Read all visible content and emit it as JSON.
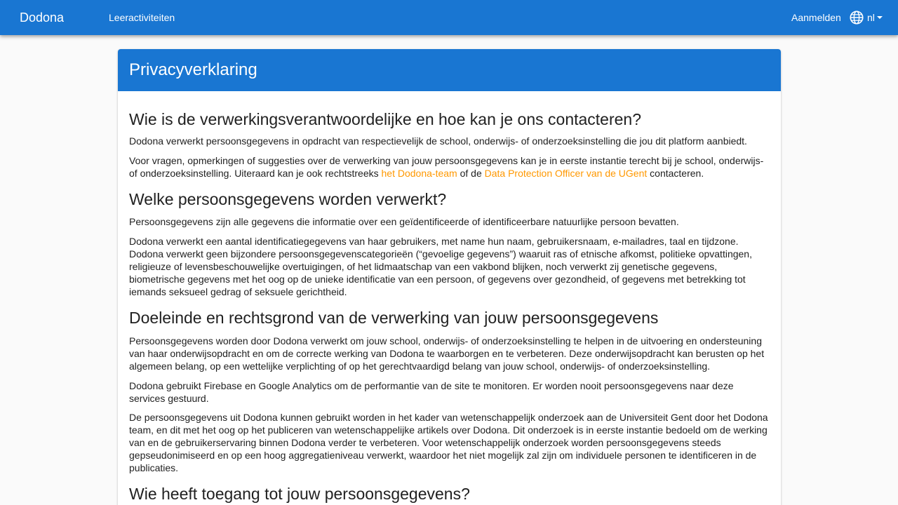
{
  "topbar": {
    "brand": "Dodona",
    "nav_link": "Leeractiviteiten",
    "login": "Aanmelden",
    "language": "nl",
    "language_icon": "globe-icon",
    "dropdown_icon": "caret-down-icon",
    "background_color": "#1976d2"
  },
  "card": {
    "title": "Privacyverklaring",
    "header_color": "#1976d2",
    "link_color": "#ff9800"
  },
  "sections": {
    "s1": {
      "heading": "Wie is de verwerkingsverantwoordelijke en hoe kan je ons contacteren?",
      "p1": "Dodona verwerkt persoonsgegevens in opdracht van respectievelijk de school, onderwijs- of onderzoeksinstelling die jou dit platform aanbiedt.",
      "p2_before": "Voor vragen, opmerkingen of suggesties over de verwerking van jouw persoonsgegevens kan je in eerste instantie terecht bij je school, onderwijs- of onderzoeksinstelling. Uiteraard kan je ook rechtstreeks ",
      "p2_link1": "het Dodona-team",
      "p2_middle": " of de ",
      "p2_link2": "Data Protection Officer van de UGent",
      "p2_after": " contacteren."
    },
    "s2": {
      "heading": "Welke persoonsgegevens worden verwerkt?",
      "p1": "Persoonsgegevens zijn alle gegevens die informatie over een geïdentificeerde of identificeerbare natuurlijke persoon bevatten.",
      "p2": "Dodona verwerkt een aantal identificatiegegevens van haar gebruikers, met name hun naam, gebruikersnaam, e-mailadres, taal en tijdzone. Dodona verwerkt geen bijzondere persoonsgegevenscategorieën (“gevoelige gegevens”) waaruit ras of etnische afkomst, politieke opvattingen, religieuze of levensbeschouwelijke overtuigingen, of het lidmaatschap van een vakbond blijken, noch verwerkt zij genetische gegevens, biometrische gegevens met het oog op de unieke identificatie van een persoon, of gegevens over gezondheid, of gegevens met betrekking tot iemands seksueel gedrag of seksuele gerichtheid."
    },
    "s3": {
      "heading": "Doeleinde en rechtsgrond van de verwerking van jouw persoonsgegevens",
      "p1": "Persoonsgegevens worden door Dodona verwerkt om jouw school, onderwijs- of onderzoeksinstelling te helpen in de uitvoering en ondersteuning van haar onderwijsopdracht en om de correcte werking van Dodona te waarborgen en te verbeteren. Deze onderwijsopdracht kan berusten op het algemeen belang, op een wettelijke verplichting of op het gerechtvaardigd belang van jouw school, onderwijs- of onderzoeksinstelling.",
      "p2": "Dodona gebruikt Firebase en Google Analytics om de performantie van de site te monitoren. Er worden nooit persoonsgegevens naar deze services gestuurd.",
      "p3": "De persoonsgegevens uit Dodona kunnen gebruikt worden in het kader van wetenschappelijk onderzoek aan de Universiteit Gent door het Dodona team, en dit met het oog op het publiceren van wetenschappelijke artikels over Dodona. Dit onderzoek is in eerste instantie bedoeld om de werking van en de gebruikerservaring binnen Dodona verder te verbeteren. Voor wetenschappelijk onderzoek worden persoonsgegevens steeds gepseudonimiseerd en op een hoog aggregatieniveau verwerkt, waardoor het niet mogelijk zal zijn om individuele personen te identificeren in de publicaties."
    },
    "s4": {
      "heading": "Wie heeft toegang tot jouw persoonsgegevens?"
    }
  }
}
